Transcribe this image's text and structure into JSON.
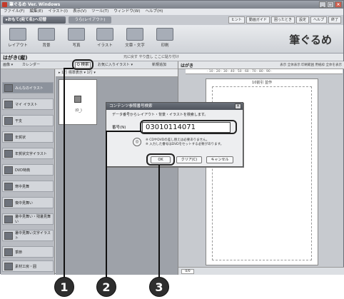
{
  "window": {
    "title": "筆ぐるめ Ver. Windows",
    "controls": [
      "_",
      "□",
      "×"
    ]
  },
  "menu": [
    "ファイル(F)",
    "編集(E)",
    "イラスト(I)",
    "表示(V)",
    "ツール(T)",
    "ウィンドウ(W)",
    "ヘルプ(H)"
  ],
  "nav": {
    "home_button": "▸おもて(宛て名)へ切替",
    "layout_tab": "うら(レイアウト)",
    "top_right": [
      "ヒント",
      "動画ガイド",
      "困ったとき",
      "設定",
      "ヘルプ",
      "終了"
    ]
  },
  "toolbar": {
    "buttons": [
      "レイアウト",
      "背景",
      "写真",
      "イラスト",
      "文章・文字",
      "印刷"
    ],
    "logo": "筆ぐるめ"
  },
  "file": {
    "title": "はがき(縦)",
    "right_tools": "元に戻す  やり直し  ここに貼り付け"
  },
  "subtool": {
    "left": "画像 ▾",
    "category": "カレンダー",
    "search_label": "Q 検索",
    "favorites": "お気に入りイラスト ▾",
    "register": "新規追加"
  },
  "sidebar": {
    "items": [
      "みんなのイラスト",
      "マイ イラスト",
      "干支",
      "年賀状",
      "年賀状文字イラスト",
      "DVD特典",
      "寒中見舞",
      "喪中見舞い",
      "暑中見舞い・残暑見舞い",
      "暑中見舞い文字イラスト",
      "季節",
      "素材工房・囲"
    ]
  },
  "panel": {
    "header": "▸ 1行    標準表示  ▾    1行    ▾",
    "card_caption": "(0_)"
  },
  "document": {
    "label": "はがき",
    "right_tools": "表示  全体表示  印刷範囲  用紙枠  全体を表示",
    "ruler": "· 10 · 20 · 30 · 40 · 50 · 60 · 70 · 80 · 90 ·",
    "paper_title": "10前引 並作",
    "page": "0/0"
  },
  "dialog": {
    "title": "コンテンツ参照番号検索",
    "message": "データ番号からレイアウト・背景・イラストを検索します。",
    "code_label": "番号(N)",
    "code_value": "03010114071",
    "note_line1": "※ CDやDVDの差し替えは必要ありません。",
    "note_line2": "※ 入力した番号はDVDをセットする必要があります。",
    "ok": "OK",
    "clear": "クリア(C)",
    "cancel": "キャンセル"
  },
  "callouts": [
    "1",
    "2",
    "3"
  ]
}
